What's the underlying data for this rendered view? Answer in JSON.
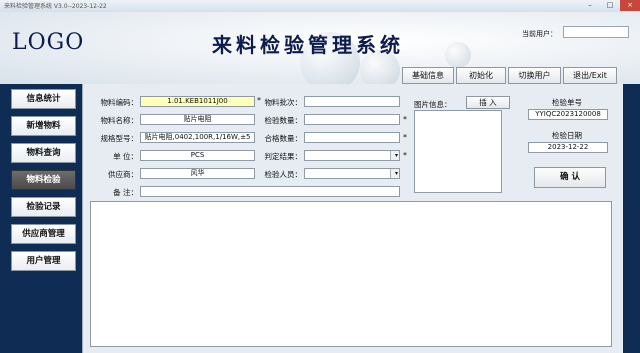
{
  "window": {
    "title": "来料检验管理系统 V3.0--2023-12-22"
  },
  "header": {
    "logo": "LOGO",
    "app_title": "来料检验管理系统",
    "user_label": "当前用户："
  },
  "toolbar": {
    "basic_info": "基础信息",
    "init": "初始化",
    "switch_user": "切换用户",
    "exit": "退出/Exit"
  },
  "sidebar": {
    "items": [
      {
        "label": "信息统计"
      },
      {
        "label": "新增物料"
      },
      {
        "label": "物料查询"
      },
      {
        "label": "物料检验"
      },
      {
        "label": "检验记录"
      },
      {
        "label": "供应商管理"
      },
      {
        "label": "用户管理"
      }
    ],
    "active_index": 3
  },
  "form": {
    "code_label": "物料编码：",
    "code_value": "1.01.KEB1011J00",
    "name_label": "物料名称：",
    "name_value": "贴片电阻",
    "spec_label": "规格型号：",
    "spec_value": "贴片电阻,0402,100R,1/16W,±5",
    "unit_label": "单 位：",
    "unit_value": "PCS",
    "supplier_label": "供应商：",
    "supplier_value": "风华",
    "remark_label": "备 注：",
    "batch_label": "物料批次：",
    "qty_label": "检验数量：",
    "pass_label": "合格数量：",
    "result_label": "判定结果：",
    "inspector_label": "检验人员：",
    "required": "*",
    "dropdown_arrow": "▾"
  },
  "image": {
    "label": "图片信息：",
    "insert_button": "插 入"
  },
  "info": {
    "no_label": "检验单号",
    "no_value": "YYIQC2023120008",
    "date_label": "检验日期",
    "date_value": "2023-12-22",
    "confirm_button": "确 认"
  }
}
